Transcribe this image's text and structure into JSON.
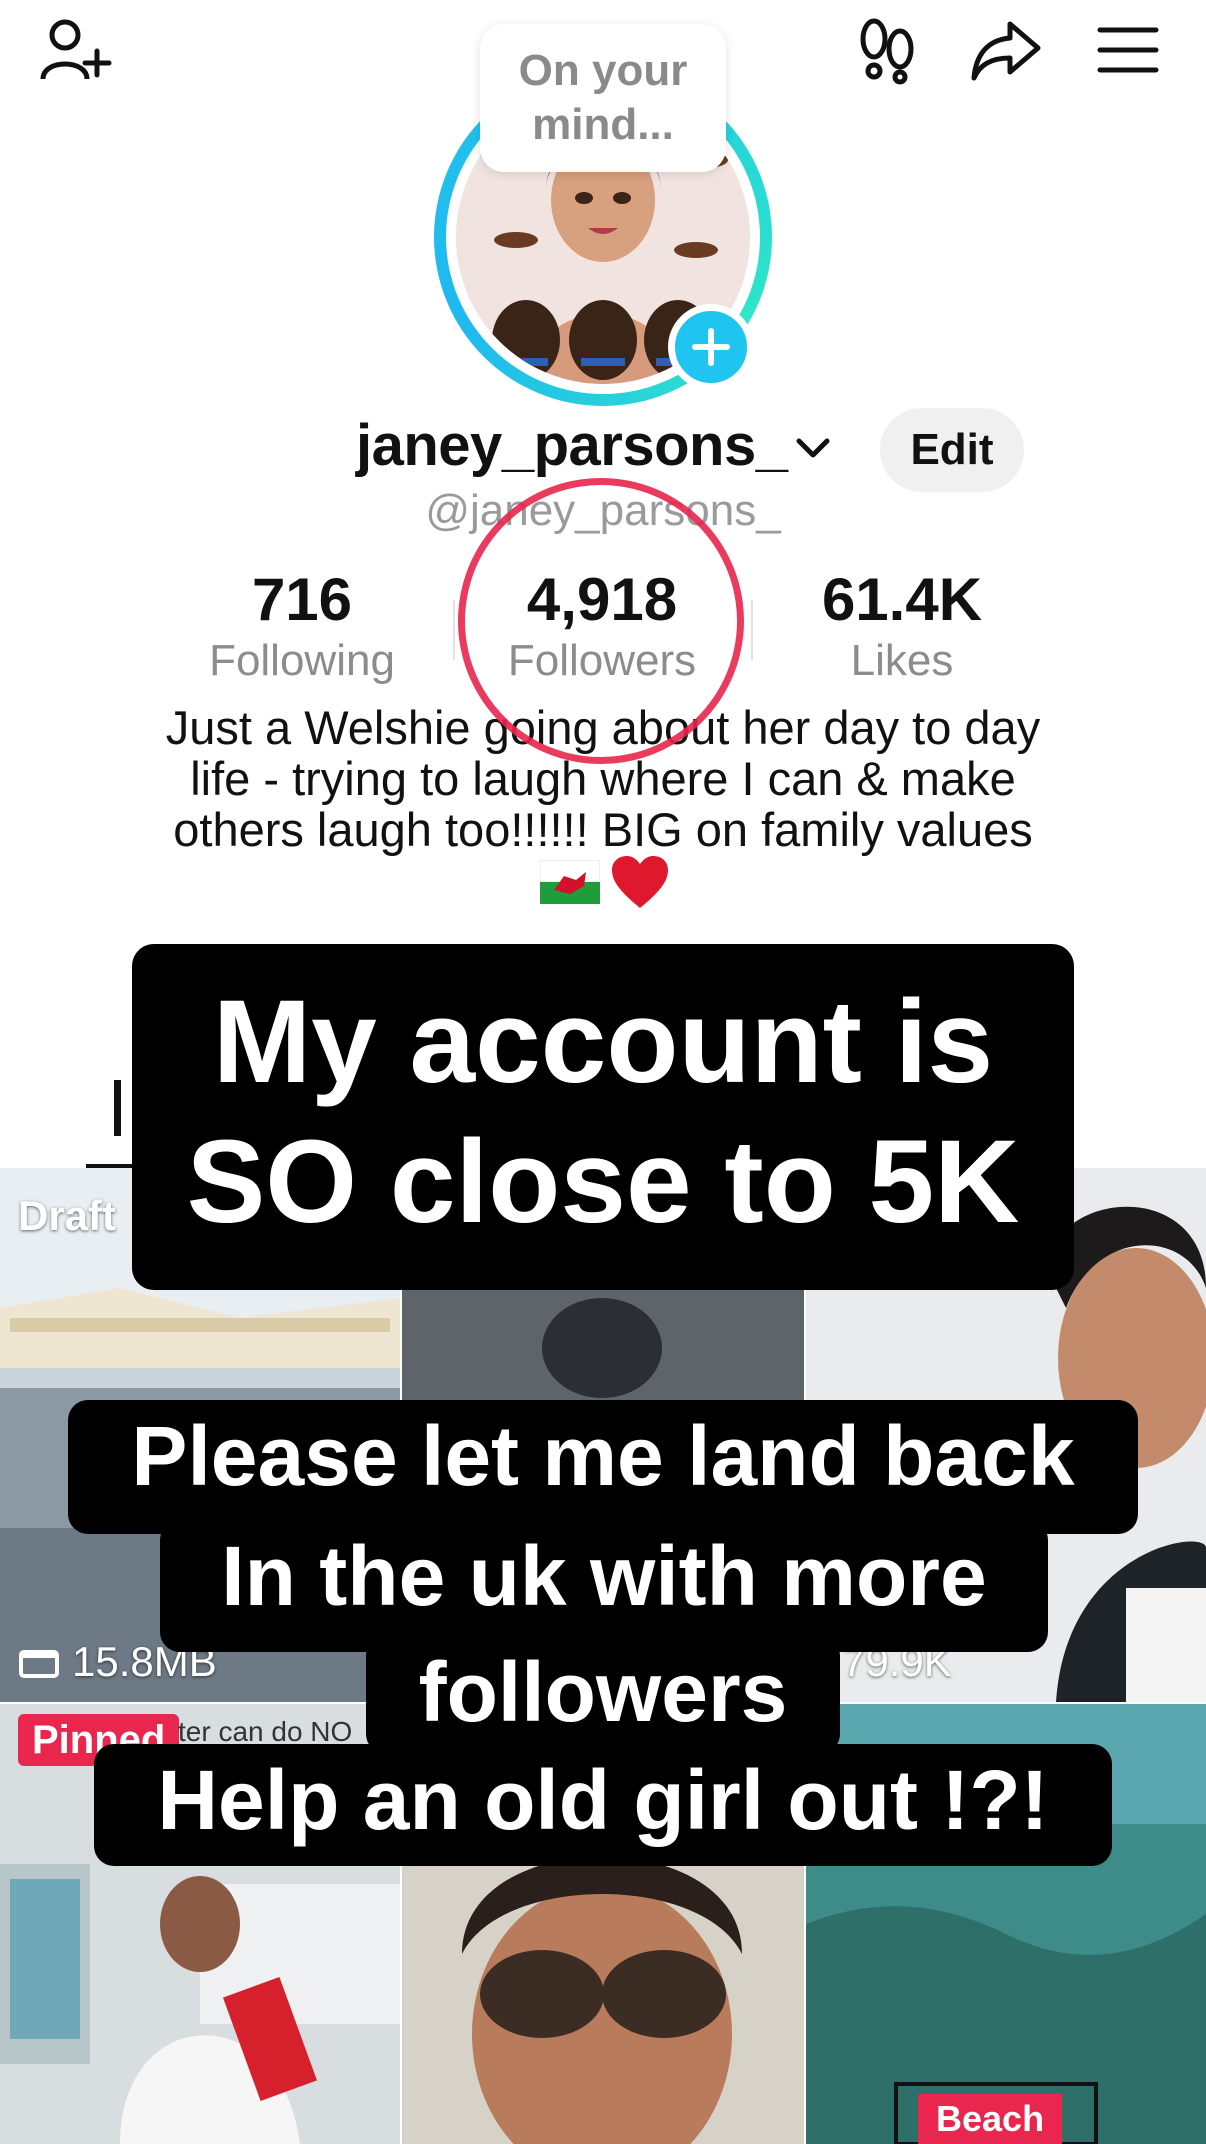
{
  "topbar": {
    "add_friend_icon": "person-plus-icon",
    "footprints_icon": "footprints-icon",
    "share_icon": "share-arrow-icon",
    "menu_icon": "hamburger-menu-icon"
  },
  "bubble": {
    "text": "On your\nmind..."
  },
  "profile": {
    "username": "janey_parsons_",
    "handle": "@janey_parsons_",
    "edit_label": "Edit",
    "bio": "Just a Welshie going about her day to day\nlife - trying to laugh where I can & make\nothers laugh too!!!!!! BIG on family values",
    "bio_emoji": [
      "welsh-flag-emoji",
      "red-heart-emoji"
    ]
  },
  "stats": [
    {
      "value": "716",
      "label": "Following"
    },
    {
      "value": "4,918",
      "label": "Followers"
    },
    {
      "value": "61.4K",
      "label": "Likes"
    }
  ],
  "grid": {
    "drafts_label": "Draft",
    "drafts_size": "15.8MB",
    "views_3": "79.9K",
    "pinned_label": "Pinned",
    "pinned_overlay_text": "ter can do NO",
    "beach_label": "Beach"
  },
  "captions": {
    "main": "My account is\nSO close to 5K",
    "line1": "Please let me land back",
    "line2": "In the uk with more",
    "line3": "followers",
    "line4": "Help an old girl out !?!"
  },
  "colors": {
    "accent_red": "#e8264e",
    "ring_cyan": "#22c7e8",
    "badge_blue": "#20c4f0"
  }
}
